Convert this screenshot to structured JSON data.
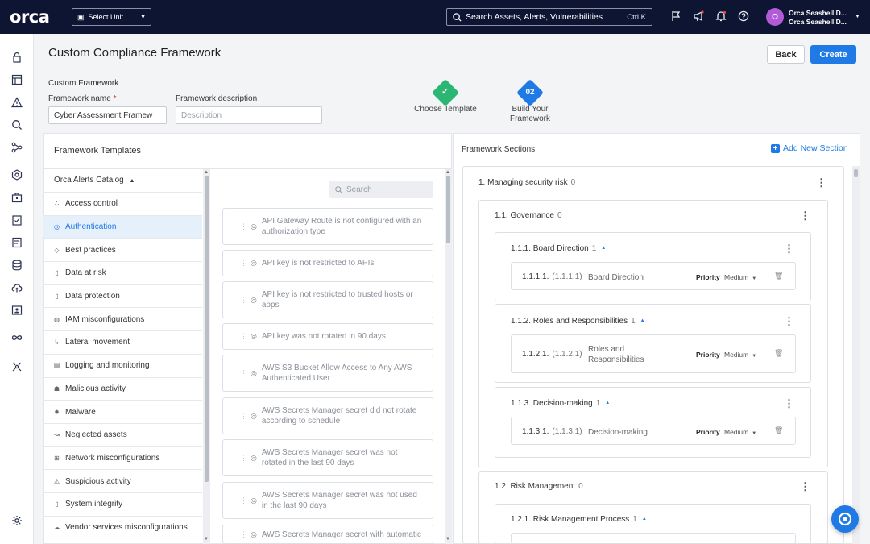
{
  "topbar": {
    "logo": "orca",
    "unit_select": "Select Unit",
    "search_placeholder": "Search Assets, Alerts, Vulnerabilities",
    "search_shortcut": "Ctrl K",
    "user_initial": "O",
    "user_name": "Orca Seashell D...",
    "user_org": "Orca Seashell D..."
  },
  "header": {
    "title": "Custom Compliance Framework",
    "back_label": "Back",
    "create_label": "Create"
  },
  "form": {
    "section_label": "Custom Framework",
    "name_label": "Framework name",
    "name_required": "*",
    "name_value": "Cyber Assessment Framew",
    "desc_label": "Framework description",
    "desc_placeholder": "Description"
  },
  "stepper": {
    "step1_label": "Choose Template",
    "step2_number": "02",
    "step2_label_line1": "Build Your",
    "step2_label_line2": "Framework"
  },
  "templates": {
    "title": "Framework Templates",
    "catalog_label": "Orca Alerts Catalog",
    "search_placeholder": "Search",
    "categories": [
      {
        "label": "Access control",
        "icon": "access-control-icon",
        "glyph": "∴"
      },
      {
        "label": "Authentication",
        "icon": "authentication-icon",
        "glyph": "◎",
        "active": true
      },
      {
        "label": "Best practices",
        "icon": "best-practices-icon",
        "glyph": "◇"
      },
      {
        "label": "Data at risk",
        "icon": "data-at-risk-icon",
        "glyph": "▯"
      },
      {
        "label": "Data protection",
        "icon": "data-protection-icon",
        "glyph": "▯"
      },
      {
        "label": "IAM misconfigurations",
        "icon": "iam-icon",
        "glyph": "◍"
      },
      {
        "label": "Lateral movement",
        "icon": "lateral-movement-icon",
        "glyph": "↳"
      },
      {
        "label": "Logging and monitoring",
        "icon": "logging-icon",
        "glyph": "▤"
      },
      {
        "label": "Malicious activity",
        "icon": "malicious-activity-icon",
        "glyph": "☗"
      },
      {
        "label": "Malware",
        "icon": "malware-icon",
        "glyph": "✹"
      },
      {
        "label": "Neglected assets",
        "icon": "neglected-assets-icon",
        "glyph": "↝"
      },
      {
        "label": "Network misconfigurations",
        "icon": "network-icon",
        "glyph": "⊞"
      },
      {
        "label": "Suspicious activity",
        "icon": "suspicious-activity-icon",
        "glyph": "⚠"
      },
      {
        "label": "System integrity",
        "icon": "system-integrity-icon",
        "glyph": "▯"
      },
      {
        "label": "Vendor services misconfigurations",
        "icon": "vendor-services-icon",
        "glyph": "☁"
      }
    ],
    "alerts": [
      {
        "line1": "API Gateway Route is not configured with an",
        "line2": "authorization type"
      },
      {
        "line1": "API key is not restricted to APIs",
        "line2": ""
      },
      {
        "line1": "API key is not restricted to trusted hosts or",
        "line2": "apps"
      },
      {
        "line1": "API key was not rotated in 90 days",
        "line2": ""
      },
      {
        "line1": "AWS S3 Bucket Allow Access to Any AWS",
        "line2": "Authenticated User"
      },
      {
        "line1": "AWS Secrets Manager secret did not rotate",
        "line2": "according to schedule"
      },
      {
        "line1": "AWS Secrets Manager secret was not",
        "line2": "rotated in the last 90 days"
      },
      {
        "line1": "AWS Secrets Manager secret was not used",
        "line2": "in the last 90 days"
      },
      {
        "line1": "AWS Secrets Manager secret with automatic",
        "line2": ""
      }
    ]
  },
  "sections": {
    "title": "Framework Sections",
    "add_label": "Add New Section",
    "top": {
      "label": "1. Managing security risk",
      "count": "0"
    },
    "gov": {
      "label": "1.1. Governance",
      "count": "0"
    },
    "board": {
      "label": "1.1.1. Board Direction",
      "count": "1"
    },
    "board_ctrl": {
      "num": "1.1.1.1.",
      "sub": "(1.1.1.1)",
      "name_line1": "Board Direction",
      "name_line2": "",
      "priority_label": "Priority",
      "priority": "Medium"
    },
    "roles": {
      "label": "1.1.2. Roles and Responsibilities",
      "count": "1"
    },
    "roles_ctrl": {
      "num": "1.1.2.1.",
      "sub": "(1.1.2.1)",
      "name_line1": "Roles and",
      "name_line2": "Responsibilities",
      "priority_label": "Priority",
      "priority": "Medium"
    },
    "dec": {
      "label": "1.1.3. Decision-making",
      "count": "1"
    },
    "dec_ctrl": {
      "num": "1.1.3.1.",
      "sub": "(1.1.3.1)",
      "name_line1": "Decision-making",
      "name_line2": "",
      "priority_label": "Priority",
      "priority": "Medium"
    },
    "risk": {
      "label": "1.2. Risk Management",
      "count": "0"
    },
    "riskproc": {
      "label": "1.2.1. Risk Management Process",
      "count": "1"
    }
  },
  "colors": {
    "accent": "#1f7ae6",
    "topbar": "#0e1533",
    "step_done": "#2bb673",
    "avatar": "#b35ad8"
  }
}
